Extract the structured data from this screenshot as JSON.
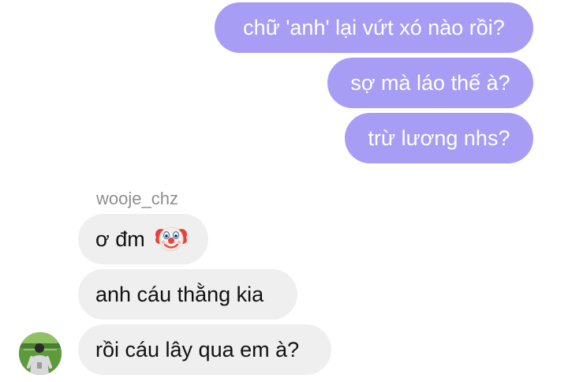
{
  "conversation": {
    "outgoing": [
      {
        "text": "chữ 'anh' lại vứt xó nào rồi?"
      },
      {
        "text": "sợ mà láo thế à?"
      },
      {
        "text": "trừ lương nhs?"
      }
    ],
    "sender_name": "wooje_chz",
    "incoming": [
      {
        "text": "ơ đm",
        "emoji": "clown-face-icon"
      },
      {
        "text": "anh cáu thằng kia"
      },
      {
        "text": "rồi cáu lây qua em à?"
      }
    ]
  },
  "colors": {
    "outgoing_bubble": "#a79df5",
    "incoming_bubble": "#efefef",
    "sender_name": "#8e8e8e",
    "background": "#ffffff"
  }
}
